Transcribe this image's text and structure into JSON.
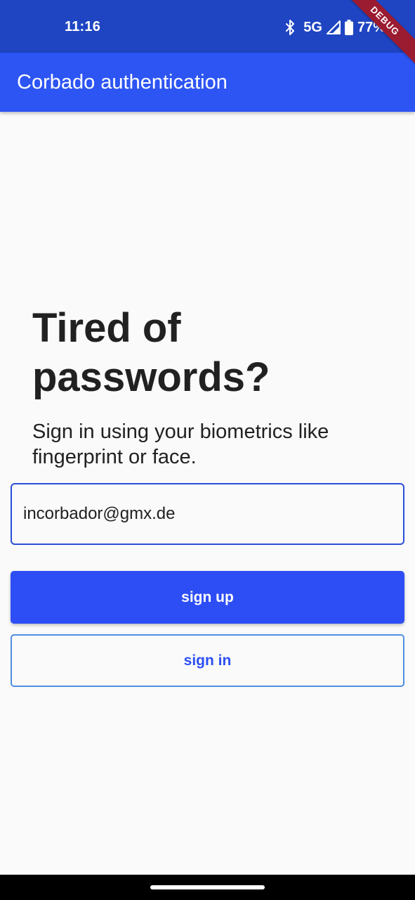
{
  "status_bar": {
    "time": "11:16",
    "network": "5G",
    "battery": "77%",
    "icons": [
      "bluetooth-icon",
      "signal-icon",
      "battery-icon"
    ]
  },
  "debug_banner": "DEBUG",
  "app_bar": {
    "title": "Corbado authentication"
  },
  "main": {
    "headline": "Tired of passwords?",
    "subtitle": "Sign in using your biometrics like fingerprint or face.",
    "email_value": "incorbador@gmx.de",
    "signup_label": "sign up",
    "signin_label": "sign in"
  },
  "colors": {
    "status_bar": "#1f45c3",
    "app_bar": "#2d55f4",
    "primary_button": "#2d4ef5",
    "outline_button_border": "#4e8ee0",
    "input_border": "#2a4fd8",
    "background": "#fafafa"
  }
}
